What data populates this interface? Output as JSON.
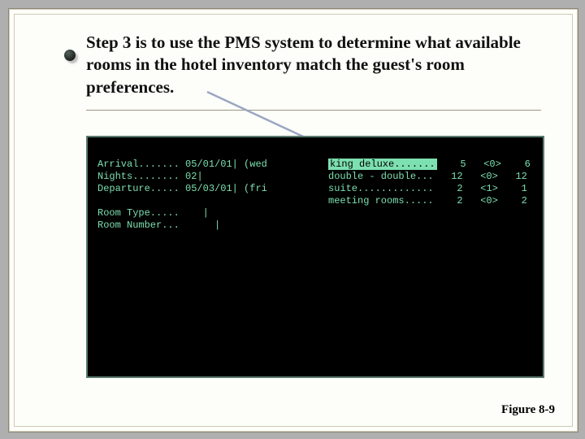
{
  "caption": "Step 3 is to use the PMS system to determine what available rooms in the hotel inventory match the guest's room preferences.",
  "figure_label": "Figure 8-9",
  "booking": {
    "arrival": {
      "label": "Arrival.......",
      "value": "05/01/01",
      "day": "(wed"
    },
    "nights": {
      "label": "Nights........",
      "value": "02",
      "day": ""
    },
    "departure": {
      "label": "Departure.....",
      "value": "05/03/01",
      "day": "(fri"
    },
    "room_type": {
      "label": "Room Type.....",
      "value": ""
    },
    "room_num": {
      "label": "Room Number...",
      "value": ""
    }
  },
  "availability": [
    {
      "name": "king deluxe.......",
      "total": "5",
      "held": "<0>",
      "avail": "6",
      "highlight": true
    },
    {
      "name": "double - double...",
      "total": "12",
      "held": "<0>",
      "avail": "12",
      "highlight": false
    },
    {
      "name": "suite.............",
      "total": "2",
      "held": "<1>",
      "avail": "1",
      "highlight": false
    },
    {
      "name": "meeting rooms.....",
      "total": "2",
      "held": "<0>",
      "avail": "2",
      "highlight": false
    }
  ]
}
